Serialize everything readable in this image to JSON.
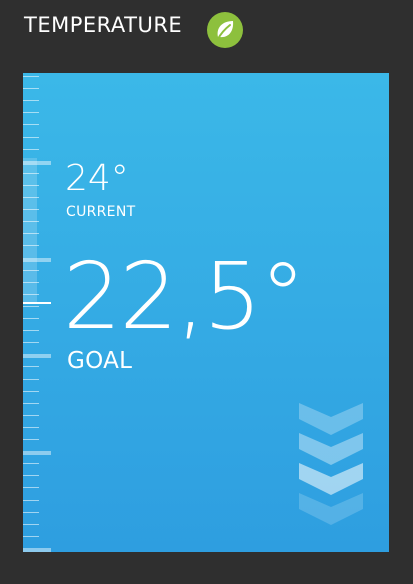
{
  "header": {
    "title": "TEMPERATURE",
    "eco_icon": "leaf-icon",
    "eco_color": "#8dc03d"
  },
  "thermostat": {
    "current": {
      "value": "24°",
      "label": "CURRENT"
    },
    "goal": {
      "value": "22,5°",
      "label": "GOAL"
    },
    "decrease_icon": "chevron-down-icon",
    "panel_colors": [
      "#3bb8e8",
      "#2e9ee0"
    ]
  }
}
